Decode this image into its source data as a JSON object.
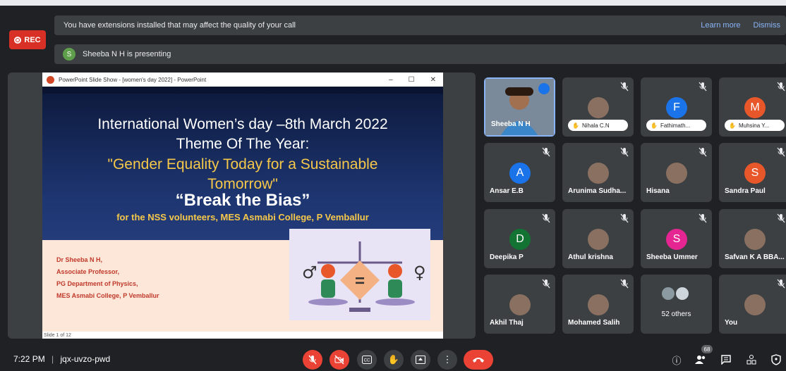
{
  "recording": {
    "label": "REC"
  },
  "banner": {
    "message": "You have extensions installed that may affect the quality of your call",
    "learn_more": "Learn more",
    "dismiss": "Dismiss"
  },
  "presenting": {
    "initial": "S",
    "text": "Sheeba N H is presenting"
  },
  "ppt": {
    "window_title": "PowerPoint Slide Show - [women's day 2022] - PowerPoint",
    "status": "Slide 1 of 12",
    "line1": "International Women’s day –8th March  2022",
    "line2": "Theme Of The Year:",
    "line3": "\"Gender Equality Today for a Sustainable Tomorrow\"",
    "line4": "“Break the Bias”",
    "line5": "for the NSS volunteers, MES Asmabi College, P Vemballur",
    "author": [
      "Dr Sheeba N H,",
      "Associate Professor,",
      "PG Department of Physics,",
      "MES Asmabi College, P Vemballur"
    ]
  },
  "participants": [
    {
      "name": "Sheeba N H",
      "type": "video"
    },
    {
      "name": "Nihala C.N",
      "type": "hand-photo"
    },
    {
      "name": "Fathimath...",
      "initial": "F",
      "color": "#1a73e8",
      "type": "hand"
    },
    {
      "name": "Muhsina Y...",
      "initial": "M",
      "color": "#e8572a",
      "type": "hand"
    },
    {
      "name": "Ansar E.B",
      "initial": "A",
      "color": "#1a73e8"
    },
    {
      "name": "Arunima Sudha...",
      "type": "photo"
    },
    {
      "name": "Hisana",
      "type": "photo"
    },
    {
      "name": "Sandra Paul",
      "initial": "S",
      "color": "#e8572a"
    },
    {
      "name": "Deepika P",
      "initial": "D",
      "color": "#137333"
    },
    {
      "name": "Athul krishna",
      "type": "photo"
    },
    {
      "name": "Sheeba Ummer",
      "initial": "S",
      "color": "#e52592"
    },
    {
      "name": "Safvan K A BBA...",
      "type": "photo"
    },
    {
      "name": "Akhil Thaj",
      "type": "photo"
    },
    {
      "name": "Mohamed Salih",
      "type": "photo"
    },
    {
      "name": "52 others",
      "type": "others"
    },
    {
      "name": "You",
      "type": "photo"
    }
  ],
  "meeting": {
    "time": "7:22 PM",
    "code": "jqx-uvzo-pwd",
    "people_count": "68"
  }
}
